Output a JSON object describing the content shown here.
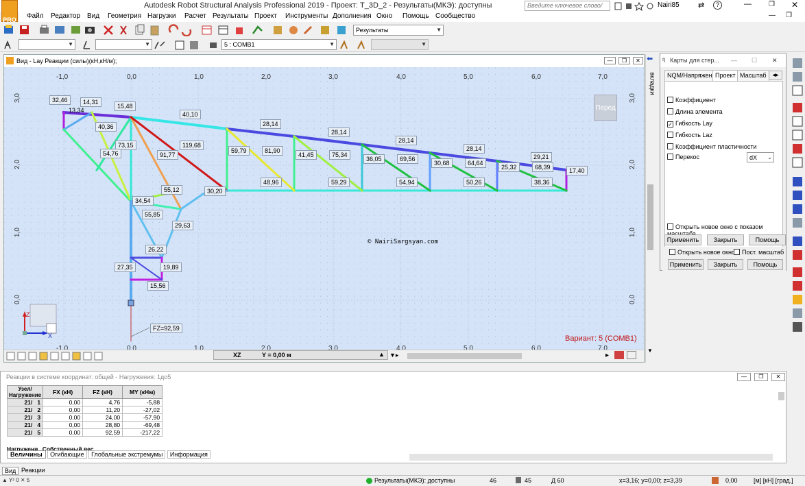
{
  "app": {
    "title": "Autodesk Robot Structural Analysis Professional 2019 - Проект: T_3D_2 - Результаты(МКЭ): доступны",
    "search_placeholder": "Введите ключевое слово/фразу",
    "user": "Nairi85",
    "logo_text": "PRO"
  },
  "menu": [
    "Файл",
    "Редактор",
    "Вид",
    "Геометрия",
    "Нагрузки",
    "Расчет",
    "Результаты",
    "Проект",
    "Инструменты",
    "Дополнения",
    "Окно",
    "Помощь",
    "Сообщество"
  ],
  "toolbar": {
    "layout_select": "Результаты",
    "load_case_select": "5 : COMB1"
  },
  "view": {
    "title": "Вид - Lay Реакции (силы)(кН,кН/м);",
    "side_tab": "вкладки",
    "view_cube": "Перед",
    "watermark": "©  NairiSargsyan.com",
    "variant": "Вариант: 5 (COMB1)",
    "plane": "XZ",
    "coord": "Y = 0,00 м",
    "axis_z": "Z",
    "axis_x": "X",
    "x_ticks": [
      "-1,0",
      "0,0",
      "1,0",
      "2,0",
      "3,0",
      "4,0",
      "5,0",
      "6,0",
      "7,0"
    ],
    "z_ticks": [
      "3,0",
      "2,0",
      "1,0",
      "0,0"
    ],
    "reaction_label": "FZ=92,59",
    "colors": {
      "background": "#d4e3f8",
      "variant_text": "#c01010"
    }
  },
  "labels": [
    "32,46",
    "14,31",
    "13,34",
    "15,48",
    "40,36",
    "73,15",
    "54,76",
    "91,77",
    "119,68",
    "40,10",
    "28,14",
    "28,14",
    "28,14",
    "28,14",
    "29,21",
    "17,40",
    "59,79",
    "81,90",
    "41,45",
    "75,34",
    "36,05",
    "69,56",
    "30,68",
    "64,64",
    "25,32",
    "68,39",
    "48,96",
    "59,29",
    "54,94",
    "50,26",
    "38,36",
    "55,12",
    "30,20",
    "34,54",
    "55,85",
    "29,63",
    "26,22",
    "27,35",
    "19,89",
    "15,56"
  ],
  "panel": {
    "title": "Карты для стер...",
    "tabs": [
      "NQM/Напряжение",
      "Проект",
      "Масштаб"
    ],
    "options": [
      {
        "label": "Коэффициент",
        "checked": false
      },
      {
        "label": "Длина элемента",
        "checked": false
      },
      {
        "label": "Гибкость Lay",
        "checked": true
      },
      {
        "label": "Гибкость Laz",
        "checked": false
      },
      {
        "label": "Коэффициент пластичности",
        "checked": false
      },
      {
        "label": "Перекос",
        "checked": false
      }
    ],
    "skew_select": "dX",
    "open_new_window_scale": "Открыть новое окно с показом масштаба",
    "apply": "Применить",
    "close": "Закрыть",
    "help": "Помощь",
    "open_new_window": "Открыть новое окно",
    "const_scale": "Пост. масштаб"
  },
  "results_table": {
    "title": "Реакции в системе координат: общей - Нагружения: 1до5",
    "headers": [
      "Узел/Нагружение",
      "FX (кН)",
      "FZ (кН)",
      "MY (кНм)"
    ],
    "rows": [
      {
        "node": "21/",
        "case": "1",
        "fx": "0,00",
        "fz": "4,76",
        "my": "-5,88"
      },
      {
        "node": "21/",
        "case": "2",
        "fx": "0,00",
        "fz": "11,20",
        "my": "-27,02"
      },
      {
        "node": "21/",
        "case": "3",
        "fx": "0,00",
        "fz": "24,00",
        "my": "-57,90"
      },
      {
        "node": "21/",
        "case": "4",
        "fx": "0,00",
        "fz": "28,80",
        "my": "-69,48"
      },
      {
        "node": "21/",
        "case": "5",
        "fx": "0,00",
        "fz": "92,59",
        "my": "-217,22"
      }
    ],
    "load_label": "Нагружени",
    "load_value": "Собственный вес",
    "tabs": [
      "Величины",
      "Огибающие",
      "Глобальные экстремумы",
      "Информация"
    ]
  },
  "subtabs": [
    "Вид",
    "Реакции"
  ],
  "status": {
    "results": "Результаты(МКЭ): доступны",
    "n1": "46",
    "n2": "45",
    "section": "Д 60",
    "coords": "x=3,16; y=0,00; z=3,39",
    "value": "0,00",
    "units": "[м] [кН] [град.]"
  }
}
